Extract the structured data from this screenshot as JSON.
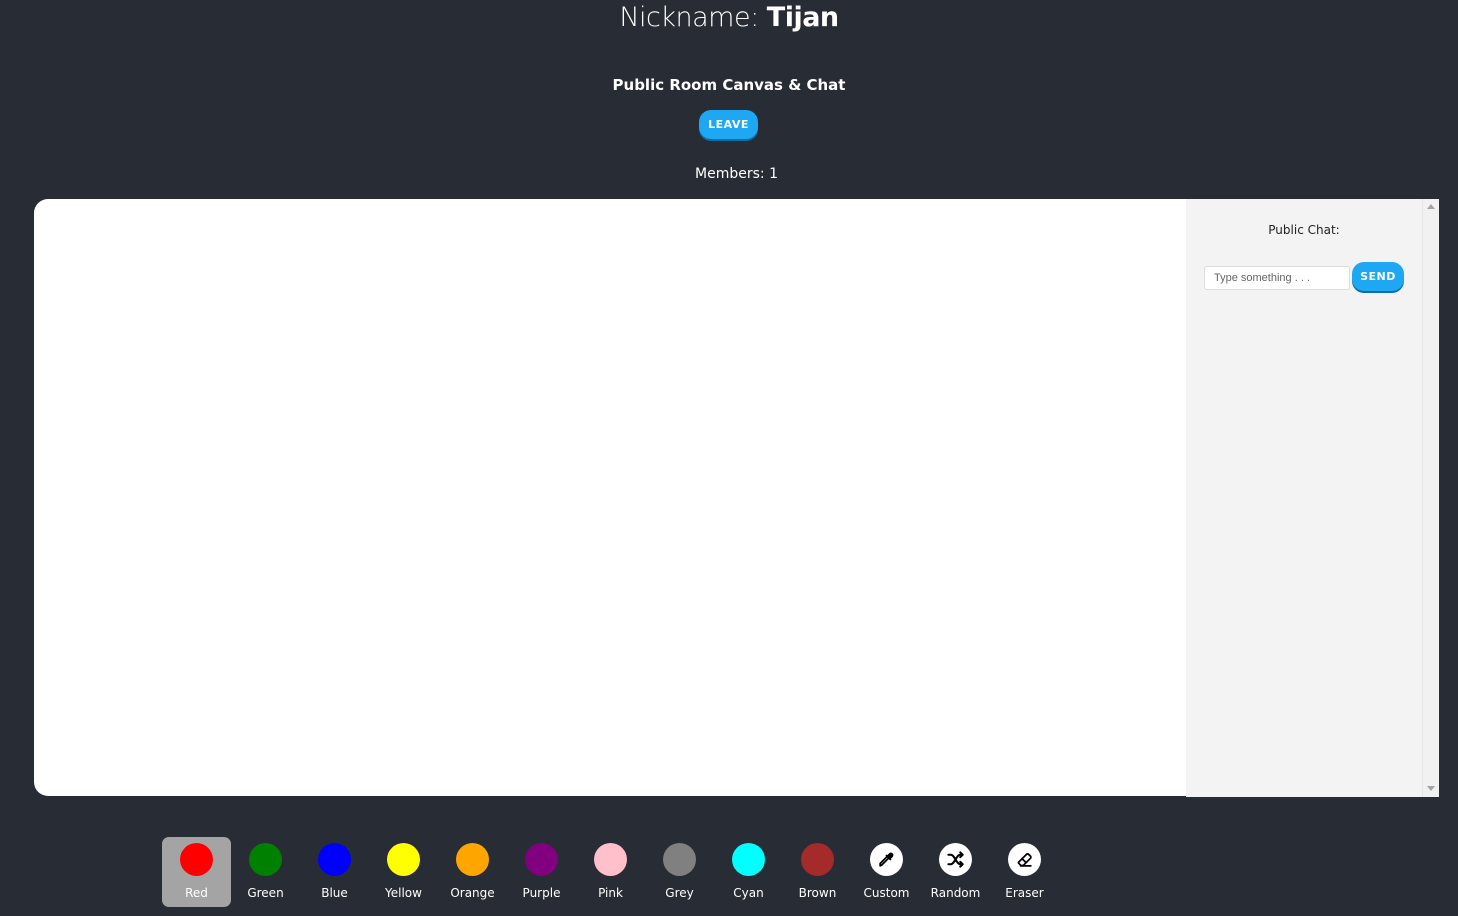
{
  "header": {
    "nickname_label": "Nickname:",
    "nickname_value": "Tijan"
  },
  "room": {
    "title": "Public Room Canvas & Chat",
    "leave_label": "LEAVE",
    "members_text": "Members: 1"
  },
  "chat": {
    "title": "Public Chat:",
    "input_value": "",
    "input_placeholder": "Type something . . .",
    "send_label": "SEND"
  },
  "palette": {
    "selected": "Red",
    "colors": [
      {
        "label": "Red",
        "color": "#ff0000"
      },
      {
        "label": "Green",
        "color": "#008000"
      },
      {
        "label": "Blue",
        "color": "#0000ff"
      },
      {
        "label": "Yellow",
        "color": "#ffff00"
      },
      {
        "label": "Orange",
        "color": "#ffa500"
      },
      {
        "label": "Purple",
        "color": "#800080"
      },
      {
        "label": "Pink",
        "color": "#ffc0cb"
      },
      {
        "label": "Grey",
        "color": "#808080"
      },
      {
        "label": "Cyan",
        "color": "#00ffff"
      },
      {
        "label": "Brown",
        "color": "#a52a2a"
      }
    ],
    "tools": [
      {
        "label": "Custom",
        "icon": "eyedropper-icon"
      },
      {
        "label": "Random",
        "icon": "shuffle-icon"
      },
      {
        "label": "Eraser",
        "icon": "eraser-icon"
      }
    ]
  }
}
